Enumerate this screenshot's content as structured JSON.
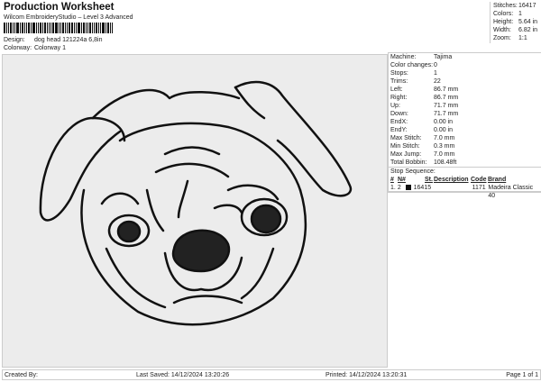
{
  "header": {
    "title": "Production Worksheet",
    "subtitle": "Wilcom EmbroideryStudio – Level 3 Advanced",
    "design_label": "Design:",
    "design_value": "dog head 121224a 6,8in",
    "colorway_label": "Colorway:",
    "colorway_value": "Colorway 1"
  },
  "summary": [
    {
      "label": "Stitches:",
      "value": "16417"
    },
    {
      "label": "Colors:",
      "value": "1"
    },
    {
      "label": "Height:",
      "value": "5.64 in"
    },
    {
      "label": "Width:",
      "value": "6.82 in"
    },
    {
      "label": "Zoom:",
      "value": "1:1"
    }
  ],
  "details": [
    {
      "label": "Machine:",
      "value": "Tajima"
    },
    {
      "label": "Color changes:",
      "value": "0"
    },
    {
      "label": "Stops:",
      "value": "1"
    },
    {
      "label": "Trims:",
      "value": "22"
    },
    {
      "label": "Left:",
      "value": "86.7 mm"
    },
    {
      "label": "Right:",
      "value": "86.7 mm"
    },
    {
      "label": "Up:",
      "value": "71.7 mm"
    },
    {
      "label": "Down:",
      "value": "71.7 mm"
    },
    {
      "label": "EndX:",
      "value": "0.00 in"
    },
    {
      "label": "EndY:",
      "value": "0.00 in"
    },
    {
      "label": "Max Stitch:",
      "value": "7.0 mm"
    },
    {
      "label": "Min Stitch:",
      "value": "0.3 mm"
    },
    {
      "label": "Max Jump:",
      "value": "7.0 mm"
    },
    {
      "label": "Total Bobbin:",
      "value": "108.48ft"
    }
  ],
  "stop_sequence": {
    "title": "Stop Sequence:",
    "headers": [
      "#",
      "N#",
      "St.",
      "Description",
      "Code",
      "Brand"
    ],
    "rows": [
      {
        "num": "1.",
        "n": "2",
        "swatch": "#111111",
        "st": "16415",
        "description": "",
        "code": "1171",
        "brand": "Madeira Classic 40"
      }
    ]
  },
  "footer": {
    "created_by": "Created By:",
    "last_saved": "Last Saved: 14/12/2024 13:20:26",
    "printed": "Printed: 14/12/2024 13:20:31",
    "page": "Page 1 of 1"
  }
}
